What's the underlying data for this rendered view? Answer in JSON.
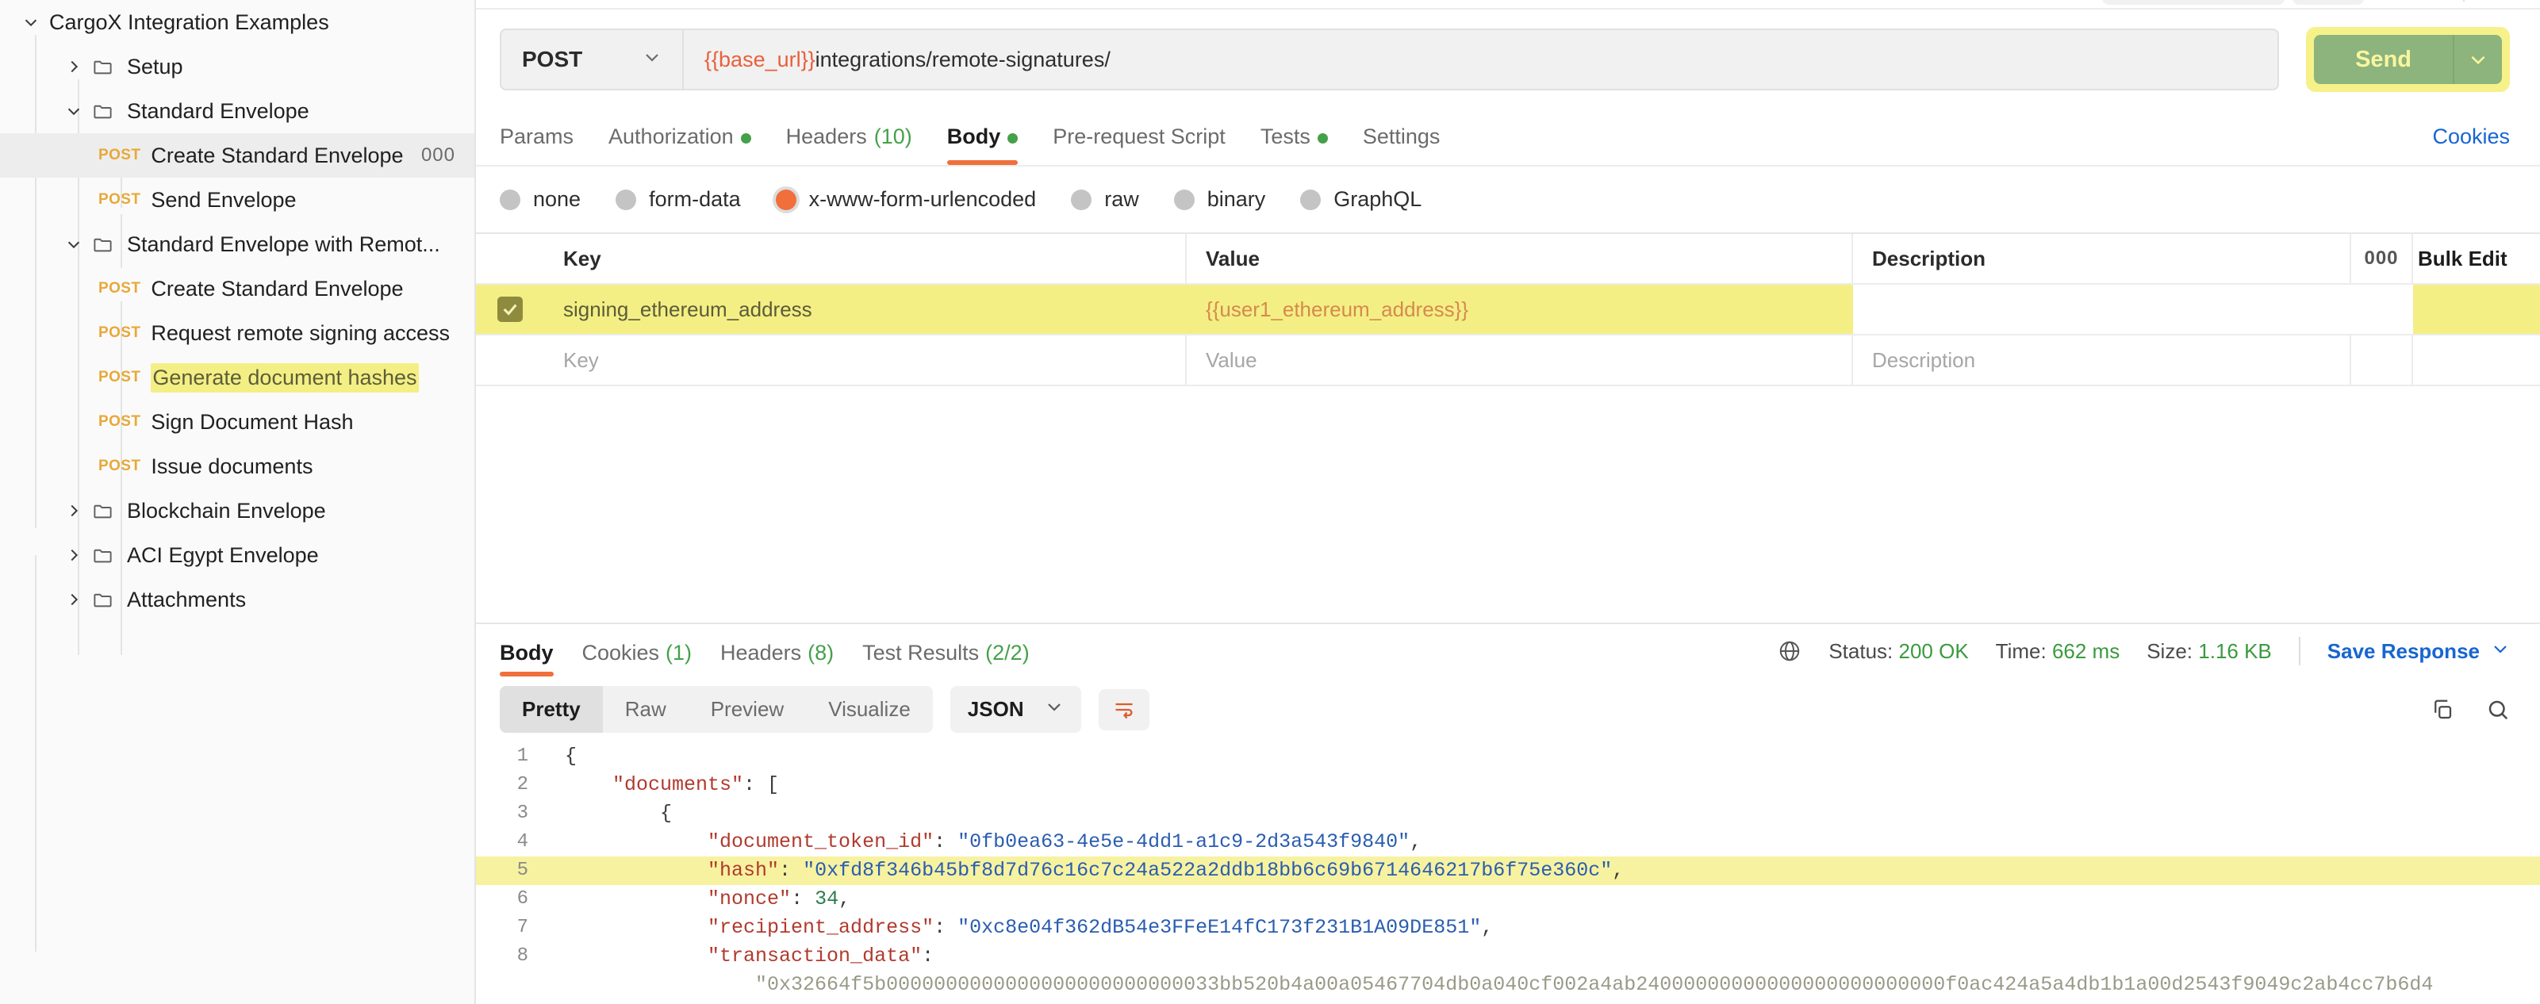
{
  "sidebar": {
    "items": [
      {
        "label": "CargoX Integration Examples",
        "type": "collection",
        "expanded": true,
        "depth": 0
      },
      {
        "label": "Setup",
        "type": "folder",
        "expanded": false,
        "depth": 1
      },
      {
        "label": "Standard Envelope",
        "type": "folder",
        "expanded": true,
        "depth": 1
      },
      {
        "label": "Create Standard Envelope",
        "type": "request",
        "method": "POST",
        "depth": 2,
        "selected": true,
        "dots": "000"
      },
      {
        "label": "Send Envelope",
        "type": "request",
        "method": "POST",
        "depth": 2
      },
      {
        "label": "Standard Envelope with Remot...",
        "type": "folder",
        "expanded": true,
        "depth": 1
      },
      {
        "label": "Create Standard Envelope",
        "type": "request",
        "method": "POST",
        "depth": 2
      },
      {
        "label": "Request remote signing access",
        "type": "request",
        "method": "POST",
        "depth": 2
      },
      {
        "label": "Generate document hashes",
        "type": "request",
        "method": "POST",
        "depth": 2,
        "highlighted": true
      },
      {
        "label": "Sign Document Hash",
        "type": "request",
        "method": "POST",
        "depth": 2
      },
      {
        "label": "Issue documents",
        "type": "request",
        "method": "POST",
        "depth": 2
      },
      {
        "label": "Blockchain Envelope",
        "type": "folder",
        "expanded": false,
        "depth": 1
      },
      {
        "label": "ACI Egypt Envelope",
        "type": "folder",
        "expanded": false,
        "depth": 1
      },
      {
        "label": "Attachments",
        "type": "folder",
        "expanded": false,
        "depth": 1
      }
    ]
  },
  "request": {
    "method": "POST",
    "url_variable": "{{base_url}}",
    "url_path": "integrations/remote-signatures/",
    "send_label": "Send",
    "tabs": [
      {
        "label": "Params",
        "active": false
      },
      {
        "label": "Authorization",
        "active": false,
        "dot": true
      },
      {
        "label": "Headers",
        "active": false,
        "count": "(10)"
      },
      {
        "label": "Body",
        "active": true,
        "dot": true
      },
      {
        "label": "Pre-request Script",
        "active": false
      },
      {
        "label": "Tests",
        "active": false,
        "dot": true
      },
      {
        "label": "Settings",
        "active": false
      }
    ],
    "cookies_link": "Cookies",
    "body_types": [
      {
        "label": "none",
        "selected": false
      },
      {
        "label": "form-data",
        "selected": false
      },
      {
        "label": "x-www-form-urlencoded",
        "selected": true
      },
      {
        "label": "raw",
        "selected": false
      },
      {
        "label": "binary",
        "selected": false
      },
      {
        "label": "GraphQL",
        "selected": false
      }
    ],
    "table": {
      "headers": {
        "key": "Key",
        "value": "Value",
        "description": "Description",
        "bulk_edit": "Bulk Edit",
        "dots": "000"
      },
      "rows": [
        {
          "checked": true,
          "key": "signing_ethereum_address",
          "value": "{{user1_ethereum_address}}",
          "description": "",
          "highlighted": true
        }
      ],
      "placeholder_row": {
        "key": "Key",
        "value": "Value",
        "description": "Description"
      }
    }
  },
  "response": {
    "tabs": [
      {
        "label": "Body",
        "active": true
      },
      {
        "label": "Cookies",
        "count": "(1)",
        "active": false
      },
      {
        "label": "Headers",
        "count": "(8)",
        "active": false
      },
      {
        "label": "Test Results",
        "count": "(2/2)",
        "active": false
      }
    ],
    "status_label": "Status:",
    "status_value": "200 OK",
    "time_label": "Time:",
    "time_value": "662 ms",
    "size_label": "Size:",
    "size_value": "1.16 KB",
    "save_response": "Save Response",
    "view_modes": [
      {
        "label": "Pretty",
        "active": true
      },
      {
        "label": "Raw",
        "active": false
      },
      {
        "label": "Preview",
        "active": false
      },
      {
        "label": "Visualize",
        "active": false
      }
    ],
    "format": "JSON",
    "body_lines": [
      {
        "n": "1",
        "indent": 0,
        "parts": [
          {
            "t": "{",
            "c": "jp"
          }
        ]
      },
      {
        "n": "2",
        "indent": 1,
        "parts": [
          {
            "t": "\"documents\"",
            "c": "jk"
          },
          {
            "t": ": [",
            "c": "jp"
          }
        ]
      },
      {
        "n": "3",
        "indent": 2,
        "parts": [
          {
            "t": "{",
            "c": "jp"
          }
        ]
      },
      {
        "n": "4",
        "indent": 3,
        "parts": [
          {
            "t": "\"document_token_id\"",
            "c": "jk"
          },
          {
            "t": ": ",
            "c": "jp"
          },
          {
            "t": "\"0fb0ea63-4e5e-4dd1-a1c9-2d3a543f9840\"",
            "c": "js"
          },
          {
            "t": ",",
            "c": "jp"
          }
        ]
      },
      {
        "n": "5",
        "indent": 3,
        "highlight": true,
        "parts": [
          {
            "t": "\"hash\"",
            "c": "jk"
          },
          {
            "t": ": ",
            "c": "jp"
          },
          {
            "t": "\"0xfd8f346b45bf8d7d76c16c7c24a522a2ddb18bb6c69b6714646217b6f75e360c\"",
            "c": "js"
          },
          {
            "t": ",",
            "c": "jp"
          }
        ]
      },
      {
        "n": "6",
        "indent": 3,
        "parts": [
          {
            "t": "\"nonce\"",
            "c": "jk"
          },
          {
            "t": ": ",
            "c": "jp"
          },
          {
            "t": "34",
            "c": "jn"
          },
          {
            "t": ",",
            "c": "jp"
          }
        ]
      },
      {
        "n": "7",
        "indent": 3,
        "parts": [
          {
            "t": "\"recipient_address\"",
            "c": "jk"
          },
          {
            "t": ": ",
            "c": "jp"
          },
          {
            "t": "\"0xc8e04f362dB54e3FFeE14fC173f231B1A09DE851\"",
            "c": "js"
          },
          {
            "t": ",",
            "c": "jp"
          }
        ]
      },
      {
        "n": "8",
        "indent": 3,
        "parts": [
          {
            "t": "\"transaction_data\"",
            "c": "jk"
          },
          {
            "t": ":",
            "c": "jp"
          }
        ]
      },
      {
        "n": "",
        "indent": 4,
        "clipped": true,
        "parts": [
          {
            "t": "\"0x32664f5b0000000000000000000000000033bb520b4a00a05467704db0a040cf002a4ab24000000000000000000000000f0ac424a5a4db1b1a00d2543f9049c2ab4cc7b6d4",
            "c": "js"
          }
        ]
      }
    ]
  }
}
